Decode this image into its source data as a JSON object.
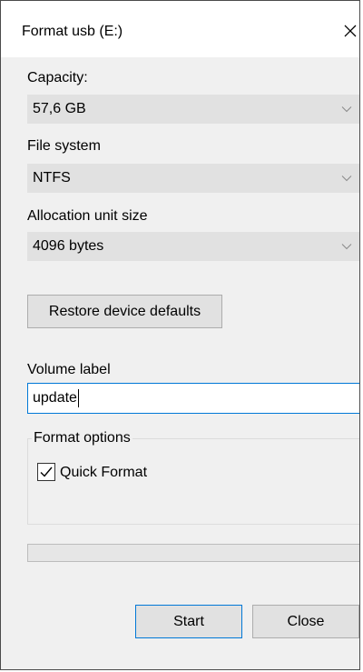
{
  "window": {
    "title": "Format usb (E:)"
  },
  "capacity": {
    "label": "Capacity:",
    "value": "57,6 GB"
  },
  "file_system": {
    "label": "File system",
    "value": "NTFS"
  },
  "allocation": {
    "label": "Allocation unit size",
    "value": "4096 bytes"
  },
  "restore_label": "Restore device defaults",
  "volume": {
    "label": "Volume label",
    "value": "update"
  },
  "format_options": {
    "title": "Format options",
    "quick_format": {
      "label": "Quick Format",
      "checked": true
    }
  },
  "progress": {
    "value": 0
  },
  "buttons": {
    "start": "Start",
    "close": "Close"
  },
  "icons": {
    "close": "close-icon",
    "dropdown": "chevron-down-icon",
    "check": "checkmark-icon"
  },
  "colors": {
    "accent": "#0078d7",
    "dialog_bg": "#f0f0f0",
    "control_bg": "#e1e1e1"
  }
}
